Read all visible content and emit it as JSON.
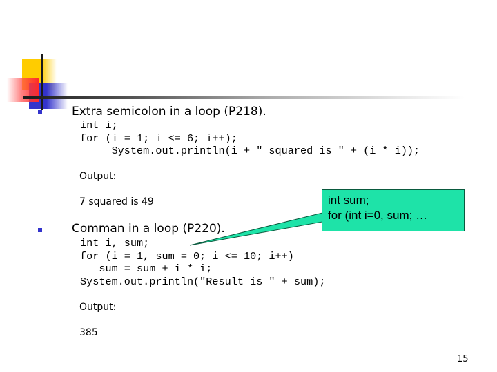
{
  "slide": {
    "page_number": "15",
    "bullets": [
      {
        "heading": "Extra semicolon in a loop (P218).",
        "code": "int i;\nfor (i = 1; i <= 6; i++);\n     System.out.println(i + \" squared is \" + (i * i));",
        "output_label": "Output:",
        "output_value": "7 squared is 49"
      },
      {
        "heading": "Comman in a loop (P220).",
        "code": "int i, sum;\nfor (i = 1, sum = 0; i <= 10; i++)\n   sum = sum + i * i;\nSystem.out.println(\"Result is \" + sum);",
        "output_label": "Output:",
        "output_value": "385"
      }
    ],
    "callout": {
      "lines": [
        "int sum;",
        "for (int i=0, sum; …"
      ],
      "fill_color": "#1ee3a8"
    },
    "colors": {
      "bullet": "#3333cc",
      "accent_yellow": "#ffcc00",
      "accent_red": "#ff2a2a",
      "accent_blue": "#3333cc"
    }
  }
}
